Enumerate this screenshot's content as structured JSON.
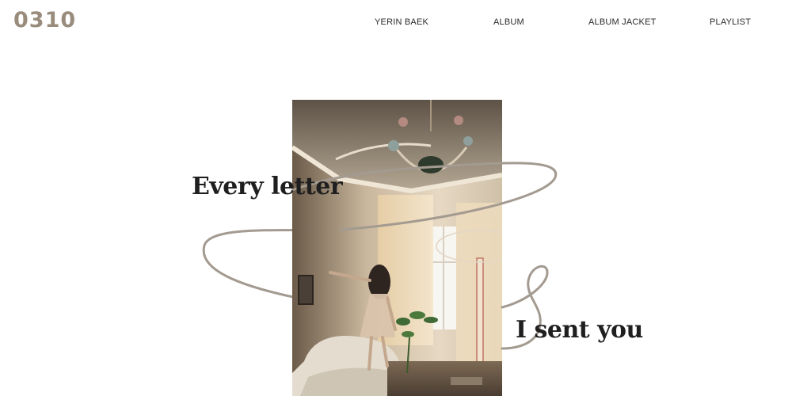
{
  "header": {
    "logo": "0310",
    "nav": [
      "YERIN BAEK",
      "ALBUM",
      "ALBUM JACKET",
      "PLAYLIST"
    ]
  },
  "hero": {
    "line1": "Every letter",
    "line2": "I sent you",
    "photo_subject": "woman standing on a sofa in a sunlit room with a chandelier",
    "colors": {
      "swirl": "#a39a90",
      "logo": "#998c7c",
      "text": "#1f1f1f"
    }
  }
}
